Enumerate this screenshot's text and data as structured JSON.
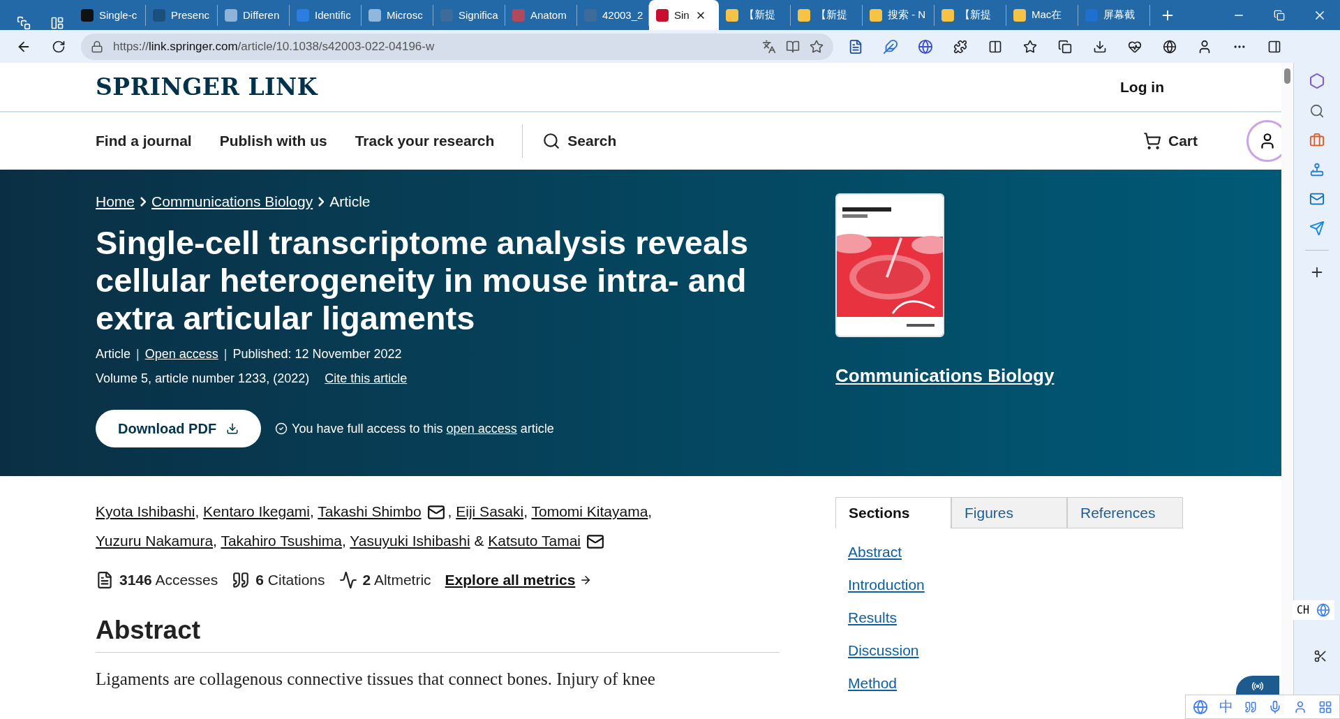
{
  "browser": {
    "tabs": [
      {
        "title": "Single-c",
        "color": "#111111",
        "selected": false
      },
      {
        "title": "Presenc",
        "color": "#1d4f7c",
        "selected": false
      },
      {
        "title": "Differen",
        "color": "#8fb3d6",
        "selected": false
      },
      {
        "title": "Identific",
        "color": "#2a7de1",
        "selected": false
      },
      {
        "title": "Microsc",
        "color": "#8fb8dc",
        "selected": false
      },
      {
        "title": "Significa",
        "color": "#3e6b99",
        "selected": false
      },
      {
        "title": "Anatom",
        "color": "#b04a5a",
        "selected": false
      },
      {
        "title": "42003_2",
        "color": "#3e6b99",
        "selected": false
      },
      {
        "title": "Sin",
        "color": "#c8102e",
        "selected": true
      },
      {
        "title": "【新提",
        "color": "#f6c344",
        "selected": false
      },
      {
        "title": "【新提",
        "color": "#f6c344",
        "selected": false
      },
      {
        "title": "搜索 - N",
        "color": "#f6c344",
        "selected": false
      },
      {
        "title": "【新提",
        "color": "#f6c344",
        "selected": false
      },
      {
        "title": "Mac在",
        "color": "#f6c344",
        "selected": false
      },
      {
        "title": "屏幕截",
        "color": "#1f6fd1",
        "selected": false
      }
    ],
    "address": {
      "scheme": "https://",
      "domain": "link.springer.com",
      "path": "/article/10.1038/s42003-022-04196-w"
    }
  },
  "header": {
    "logo": "SPRINGER LINK",
    "login": "Log in"
  },
  "nav": {
    "items": [
      "Find a journal",
      "Publish with us",
      "Track your research"
    ],
    "search": "Search",
    "cart": "Cart"
  },
  "hero": {
    "breadcrumbs": [
      {
        "label": "Home",
        "link": true
      },
      {
        "label": "Communications Biology",
        "link": true
      },
      {
        "label": "Article",
        "link": false
      }
    ],
    "title": "Single-cell transcriptome analysis reveals cellular heterogeneity in mouse intra- and extra articular ligaments",
    "meta": [
      {
        "label": "Article",
        "link": false
      },
      {
        "sep": "|",
        "label": "Open access",
        "link": true
      },
      {
        "sep": "|",
        "label": "Published: 12 November 2022",
        "link": false
      }
    ],
    "volume": "Volume 5, article number 1233, (2022)",
    "cite": "Cite this article",
    "download": "Download PDF",
    "access": {
      "before": "You have full access to this",
      "link": "open access",
      "after": "article"
    },
    "journal": "Communications Biology"
  },
  "authors": [
    {
      "name": "Kyota Ishibashi",
      "sep": ","
    },
    {
      "name": "Kentaro Ikegami",
      "sep": ","
    },
    {
      "name": "Takashi Shimbo",
      "sep": ",",
      "mail": true
    },
    {
      "name": "Eiji Sasaki",
      "sep": ","
    },
    {
      "name": "Tomomi Kitayama",
      "sep": ","
    },
    {
      "name": "Yuzuru Nakamura",
      "sep": ","
    },
    {
      "name": "Takahiro Tsushima",
      "sep": ","
    },
    {
      "name": "Yasuyuki Ishibashi",
      "sep": " &"
    },
    {
      "name": "Katsuto Tamai",
      "mail": true
    }
  ],
  "metrics": [
    {
      "kind": "accesses",
      "value": "3146",
      "label": "Accesses"
    },
    {
      "kind": "citations",
      "value": "6",
      "label": "Citations"
    },
    {
      "kind": "altmetric",
      "value": "2",
      "label": "Altmetric"
    }
  ],
  "explore": "Explore all metrics",
  "abstract": {
    "heading": "Abstract",
    "text": "Ligaments are collagenous connective tissues that connect bones. Injury of knee"
  },
  "side_tabs": [
    {
      "label": "Sections",
      "selected": true
    },
    {
      "label": "Figures",
      "selected": false
    },
    {
      "label": "References",
      "selected": false
    }
  ],
  "sections": [
    "Abstract",
    "Introduction",
    "Results",
    "Discussion",
    "Method"
  ],
  "ime": {
    "lang": "CH",
    "mode": "中"
  }
}
